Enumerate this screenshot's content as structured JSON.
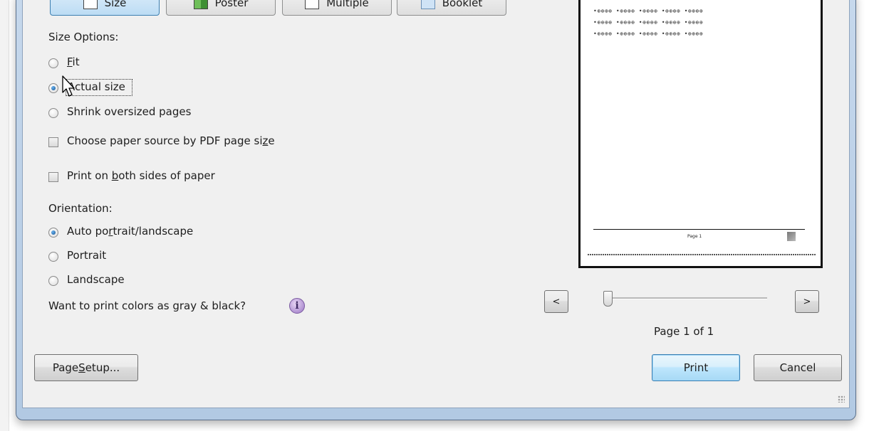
{
  "tabs": [
    {
      "label": "Size",
      "icon": "size-icon"
    },
    {
      "label": "Poster",
      "icon": "poster-icon"
    },
    {
      "label": "Multiple",
      "icon": "multiple-icon"
    },
    {
      "label": "Booklet",
      "icon": "booklet-icon"
    }
  ],
  "size_options": {
    "heading": "Size Options:",
    "fit_access": "F",
    "fit_rest": "it",
    "actual_size": "Actual size",
    "shrink": "Shrink oversized pages",
    "selected": "Actual size"
  },
  "paper_source": {
    "label_pre": "Choose paper source by PDF page si",
    "label_key": "z",
    "label_post": "e",
    "checked": false
  },
  "both_sides": {
    "label_pre": "Print on ",
    "label_key": "b",
    "label_post": "oth sides of paper",
    "checked": false
  },
  "orientation": {
    "heading": "Orientation:",
    "auto_pre": "Auto po",
    "auto_key": "r",
    "auto_post": "trait/landscape",
    "portrait": "Portrait",
    "landscape": "Landscape",
    "selected": "Auto portrait/landscape"
  },
  "gray_prompt": "Want to print colors as gray & black?",
  "info_glyph": "i",
  "preview": {
    "dot_rows": [
      "·○○○○○  ·○○○○○  ·○○○○○  ·○○○○○  ·○○○○○",
      "•⊕⊕⊕⊕  •⊕⊕⊕⊕  •⊕⊕⊕⊕  •⊕⊕⊕⊕  •⊕⊕⊕⊕",
      "•⊕⊕⊕⊕  •⊕⊕⊕⊕  •⊕⊕⊕⊕  •⊕⊕⊕⊕  •⊕⊕⊕⊕",
      "•⊕⊕⊕⊕  •⊕⊕⊕⊕  •⊕⊕⊕⊕  •⊕⊕⊕⊕  •⊕⊕⊕⊕"
    ],
    "footer_page": "Page 1"
  },
  "nav": {
    "prev": "<",
    "next": ">",
    "page_status": "Page 1 of 1"
  },
  "buttons": {
    "page_setup_pre": "Page ",
    "page_setup_key": "S",
    "page_setup_post": "etup...",
    "print": "Print",
    "cancel": "Cancel"
  }
}
